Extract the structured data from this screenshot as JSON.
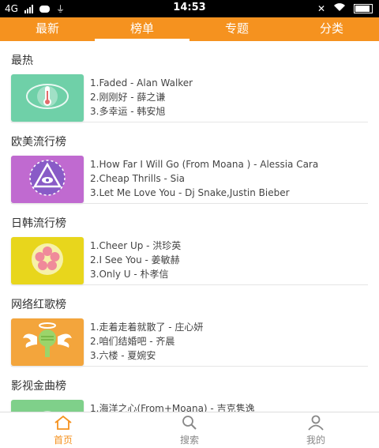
{
  "status": {
    "network": "4G",
    "time": "14:53"
  },
  "tabs": [
    {
      "label": "最新"
    },
    {
      "label": "榜单",
      "active": true
    },
    {
      "label": "专题"
    },
    {
      "label": "分类"
    }
  ],
  "sections": [
    {
      "title": "最热",
      "cover_color": "#6fd0a8",
      "cover_icon": "thermometer-eye-icon",
      "items": [
        "1.Faded - Alan Walker",
        "2.刚刚好 - 薛之谦",
        "3.多幸运 - 韩安旭"
      ]
    },
    {
      "title": "欧美流行榜",
      "cover_color": "#c06ad0",
      "cover_icon": "triangle-eye-icon",
      "items": [
        "1.How Far I Will Go (From Moana ) - Alessia Cara",
        "2.Cheap Thrills - Sia",
        "3.Let Me Love You - Dj Snake,Justin Bieber"
      ]
    },
    {
      "title": "日韩流行榜",
      "cover_color": "#e8d61c",
      "cover_icon": "flower-icon",
      "items": [
        "1.Cheer Up - 洪珍英",
        "2.I See You - 姜敏赫",
        "3.Only U - 朴孝信"
      ]
    },
    {
      "title": "网络红歌榜",
      "cover_color": "#f3a53c",
      "cover_icon": "winged-microphone-icon",
      "items": [
        "1.走着走着就散了 - 庄心妍",
        "2.咱们结婚吧 - 齐晨",
        "3.六楼 - 夏婉安"
      ]
    },
    {
      "title": "影视金曲榜",
      "cover_color": "#7fd08a",
      "cover_icon": "film-icon",
      "items": [
        "1.海洋之心(From+Moana) - 吉克隽逸"
      ]
    }
  ],
  "bottom_nav": [
    {
      "label": "首页",
      "icon": "home-icon",
      "active": true
    },
    {
      "label": "搜索",
      "icon": "search-icon"
    },
    {
      "label": "我的",
      "icon": "user-icon"
    }
  ],
  "colors": {
    "accent": "#f5921f"
  }
}
